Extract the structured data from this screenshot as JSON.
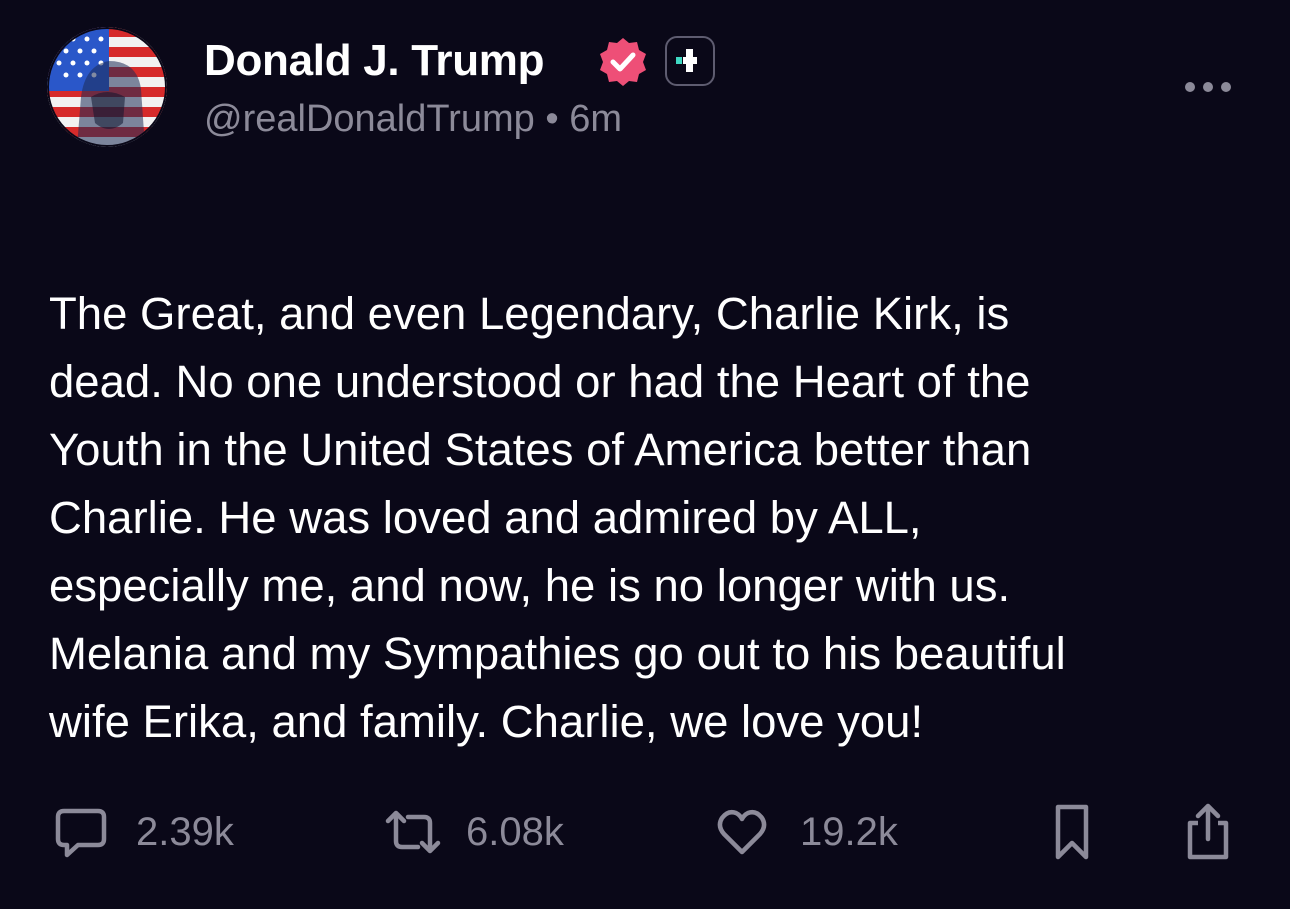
{
  "author": {
    "display_name": "Donald J. Trump",
    "handle": "@realDonaldTrump",
    "separator": "•",
    "timestamp": "6m",
    "verified_icon": "verified-check-icon",
    "plus_icon": "plus-badge-icon",
    "avatar": "profile-avatar"
  },
  "post": {
    "lines": [
      "The Great, and even Legendary, Charlie Kirk, is",
      "dead. No one understood or had the Heart of the",
      "Youth in the United States of America better than",
      "Charlie. He was loved and admired by ALL,",
      "especially me, and now, he is no longer with us.",
      "Melania and my Sympathies go out to his beautiful",
      "wife Erika, and family. Charlie, we love you!"
    ]
  },
  "actions": {
    "reply": {
      "icon": "reply-icon",
      "count": "2.39k"
    },
    "repost": {
      "icon": "repost-icon",
      "count": "6.08k"
    },
    "like": {
      "icon": "heart-icon",
      "count": "19.2k"
    },
    "bookmark": {
      "icon": "bookmark-icon"
    },
    "share": {
      "icon": "share-icon"
    },
    "more": {
      "icon": "more-icon"
    }
  },
  "colors": {
    "background": "#0a0818",
    "text": "#ffffff",
    "muted": "#8c8a99",
    "verified": "#ee4f77",
    "plus_accent": "#3fd9c3"
  }
}
